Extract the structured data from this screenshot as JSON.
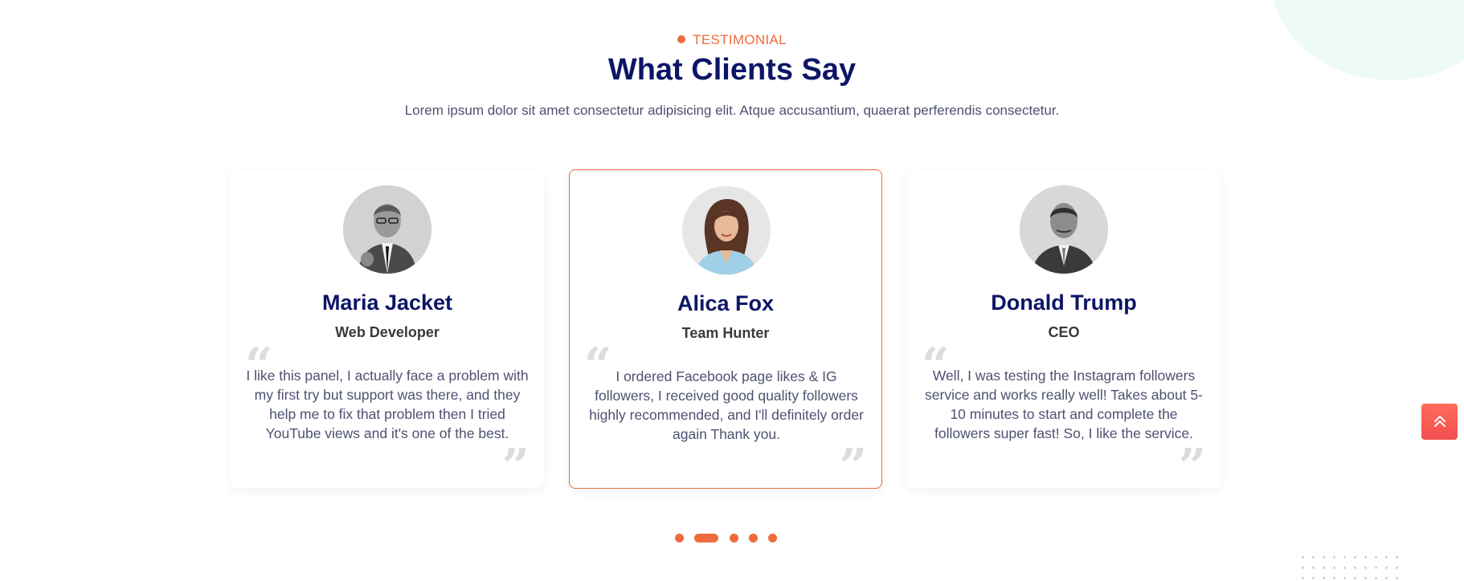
{
  "section": {
    "tag": "TESTIMONIAL",
    "heading": "What Clients Say",
    "subtitle": "Lorem ipsum dolor sit amet consectetur adipisicing elit. Atque accusantium, quaerat perferendis consectetur."
  },
  "testimonials": [
    {
      "name": "Maria Jacket",
      "role": "Web Developer",
      "text": "I like this panel, I actually face a problem with my first try but support was there, and they help me to fix that problem then I tried YouTube views and it's one of the best."
    },
    {
      "name": "Alica Fox",
      "role": "Team Hunter",
      "text": "I ordered Facebook page likes & IG followers, I received good quality followers highly recommended, and I'll definitely order again Thank you."
    },
    {
      "name": "Donald Trump",
      "role": "CEO",
      "text": "Well, I was testing the Instagram followers service and works really well! Takes about 5-10 minutes to start and complete the followers super fast! So, I like the service."
    }
  ],
  "pagination": {
    "count": 5,
    "active_index": 1
  },
  "colors": {
    "accent": "#ef6a3c",
    "heading": "#0c1566",
    "body_text": "#4d5170",
    "scroll_top": "#f24f4f"
  },
  "icons": {
    "quote_open": "quote-open-icon",
    "quote_close": "quote-close-icon",
    "scroll_top": "chevrons-up-icon"
  }
}
